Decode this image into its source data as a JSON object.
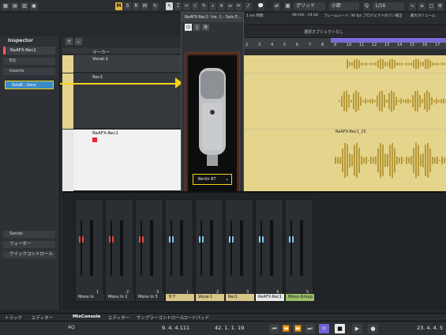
{
  "toolbar": {
    "mode_buttons": [
      "M",
      "S",
      "R",
      "W"
    ],
    "grid_label": "グリッド",
    "bar_label": "小節",
    "quant_label": "1/16"
  },
  "info": {
    "a": "48 kHz - 24 bit",
    "b": "フレームレート: 30 fps",
    "c": "プロジェクトのパン補正",
    "d": "最大ボリューム",
    "e": "1 ms 時間",
    "select_label": "選択オブジェクトなし"
  },
  "inspector": {
    "tab": "Inspector",
    "track_name": "ReAFX-Rec1",
    "sections": [
      "EQ",
      "Inserts",
      "Sends",
      "フェーダー",
      "クイックコントロール"
    ],
    "insert_slot": "SoloE...tions"
  },
  "plugin": {
    "title": "ReAFX-Rec1: Ins. 1 - Solo E...",
    "preset": "Berlin 87",
    "brand": "u"
  },
  "tracks": [
    {
      "num": "1",
      "name": "マーカー"
    },
    {
      "num": "2",
      "name": "Vocal-1"
    },
    {
      "num": "3",
      "name": "Rec1"
    },
    {
      "num": "4",
      "name": "ReAFX-Rec1"
    }
  ],
  "ruler": [
    "2",
    "3",
    "4",
    "5",
    "6",
    "7",
    "8",
    "9",
    "10",
    "11",
    "12",
    "13",
    "14",
    "15",
    "16",
    "17"
  ],
  "clip_label": "ReAFX-Rec1_15",
  "mixer": {
    "channels": [
      {
        "name": "Mono In",
        "num": "1",
        "color": "#2b2e32",
        "fader_color": "#e14a4a"
      },
      {
        "name": "Mono In 2",
        "num": "2",
        "color": "#2b2e32",
        "fader_color": "#e14a4a"
      },
      {
        "name": "Mono In 3",
        "num": "3",
        "color": "#2b2e32",
        "fader_color": "#e14a4a"
      },
      {
        "name": "タテ",
        "num": "1",
        "color": "#d6c688",
        "fader_color": "#7fd0ef"
      },
      {
        "name": "Vocal-1",
        "num": "2",
        "color": "#d6c688",
        "fader_color": "#7fd0ef"
      },
      {
        "name": "Rec1",
        "num": "3",
        "color": "#d6c688",
        "fader_color": "#7fd0ef"
      },
      {
        "name": "ReAFX-Rec1",
        "num": "4",
        "color": "#e8e8e8",
        "fader_color": "#7fd0ef"
      },
      {
        "name": "Mono-Group",
        "num": "5",
        "color": "#9bbf6a",
        "fader_color": "#7fd0ef"
      }
    ]
  },
  "tabs": {
    "left": [
      "トラック",
      "エディター"
    ],
    "right": [
      "MixConsole",
      "エディター",
      "サンプラーコントロール",
      "コードパッド"
    ]
  },
  "transport": {
    "left_pos": "9. 4. 4.111",
    "pos": "42. 1. 1. 19",
    "right_pos": "23. 4. 4. 5",
    "aq": "AQ"
  }
}
